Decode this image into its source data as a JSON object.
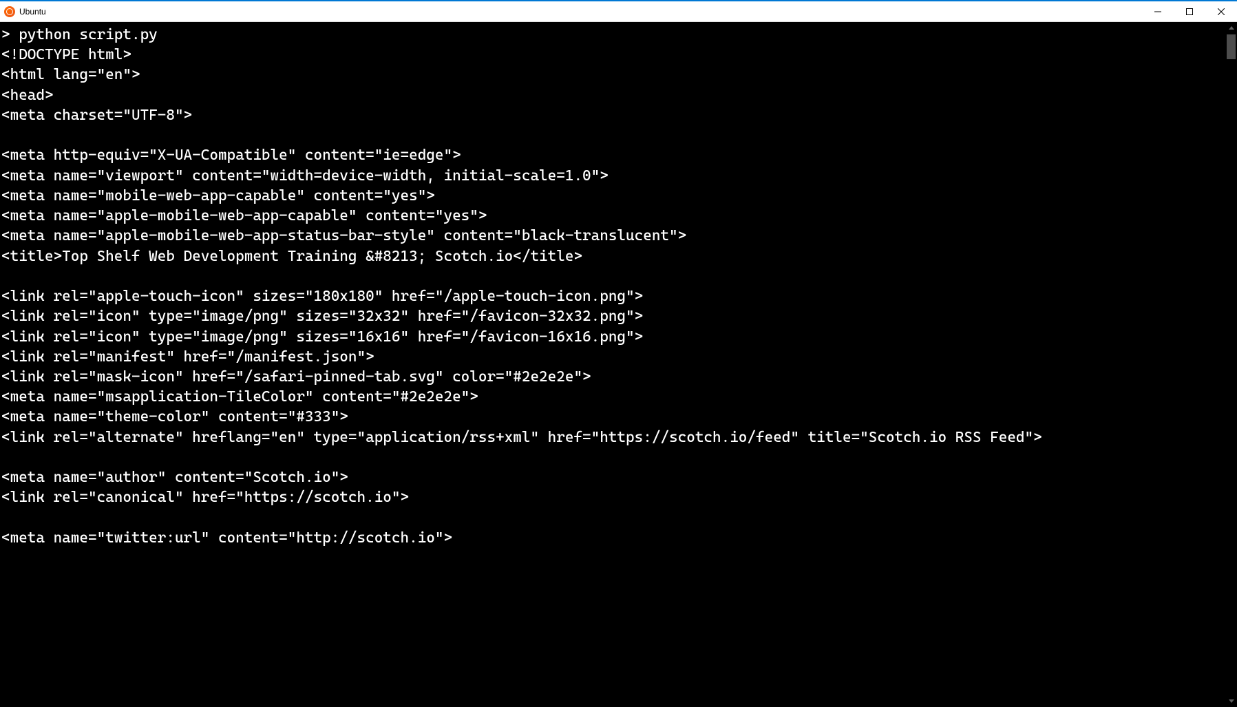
{
  "window": {
    "title": "Ubuntu"
  },
  "terminal": {
    "lines": [
      "> python script.py",
      "<!DOCTYPE html>",
      "<html lang=\"en\">",
      "<head>",
      "<meta charset=\"UTF-8\">",
      "",
      "<meta http-equiv=\"X-UA-Compatible\" content=\"ie=edge\">",
      "<meta name=\"viewport\" content=\"width=device-width, initial-scale=1.0\">",
      "<meta name=\"mobile-web-app-capable\" content=\"yes\">",
      "<meta name=\"apple-mobile-web-app-capable\" content=\"yes\">",
      "<meta name=\"apple-mobile-web-app-status-bar-style\" content=\"black-translucent\">",
      "<title>Top Shelf Web Development Training &#8213; Scotch.io</title>",
      "",
      "<link rel=\"apple-touch-icon\" sizes=\"180x180\" href=\"/apple-touch-icon.png\">",
      "<link rel=\"icon\" type=\"image/png\" sizes=\"32x32\" href=\"/favicon-32x32.png\">",
      "<link rel=\"icon\" type=\"image/png\" sizes=\"16x16\" href=\"/favicon-16x16.png\">",
      "<link rel=\"manifest\" href=\"/manifest.json\">",
      "<link rel=\"mask-icon\" href=\"/safari-pinned-tab.svg\" color=\"#2e2e2e\">",
      "<meta name=\"msapplication-TileColor\" content=\"#2e2e2e\">",
      "<meta name=\"theme-color\" content=\"#333\">",
      "<link rel=\"alternate\" hreflang=\"en\" type=\"application/rss+xml\" href=\"https://scotch.io/feed\" title=\"Scotch.io RSS Feed\">",
      "",
      "<meta name=\"author\" content=\"Scotch.io\">",
      "<link rel=\"canonical\" href=\"https://scotch.io\">",
      "",
      "<meta name=\"twitter:url\" content=\"http://scotch.io\">"
    ]
  }
}
